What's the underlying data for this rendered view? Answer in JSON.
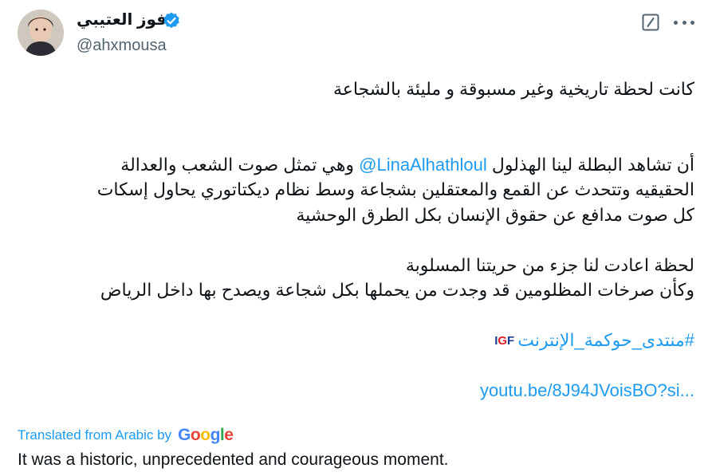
{
  "author": {
    "name": "فوز العتيبي",
    "handle": "@ahxmousa",
    "verified": true
  },
  "tweet": {
    "line1": "كانت لحظة تاريخية وغير مسبوقة و مليئة بالشجاعة",
    "line2_pre": "أن تشاهد البطلة لينا الهذلول ",
    "line2_mention": "@LinaAlhathloul",
    "line2_post": " وهي تمثل صوت الشعب والعدالة",
    "line3": "الحقيقيه وتتحدث عن القمع والمعتقلين بشجاعة وسط نظام ديكتاتوري يحاول إسكات",
    "line4": "كل صوت مدافع عن حقوق الإنسان بكل الطرق الوحشية",
    "line5": "لحظة اعادت لنا جزء من حريتنا المسلوبة",
    "line6": "وكأن صرخات المظلومين قد وجدت من يحملها بكل شجاعة ويصدح بها داخل الرياض",
    "hashtag": "#منتدى_حوكمة_الإنترنت",
    "hashtag_emoji": {
      "i": "I",
      "g": "G",
      "f": "F"
    },
    "link": "youtu.be/8J94JVoisBO?si..."
  },
  "translation": {
    "label": "Translated from Arabic by",
    "provider": "Google",
    "text": "It was a historic, unprecedented and courageous moment."
  },
  "icons": {
    "grok": "grok-icon",
    "more": "more-icon",
    "verified": "verified-badge-icon"
  },
  "colors": {
    "accent": "#1d9bf0",
    "text": "#0f1419",
    "secondary": "#536471"
  }
}
